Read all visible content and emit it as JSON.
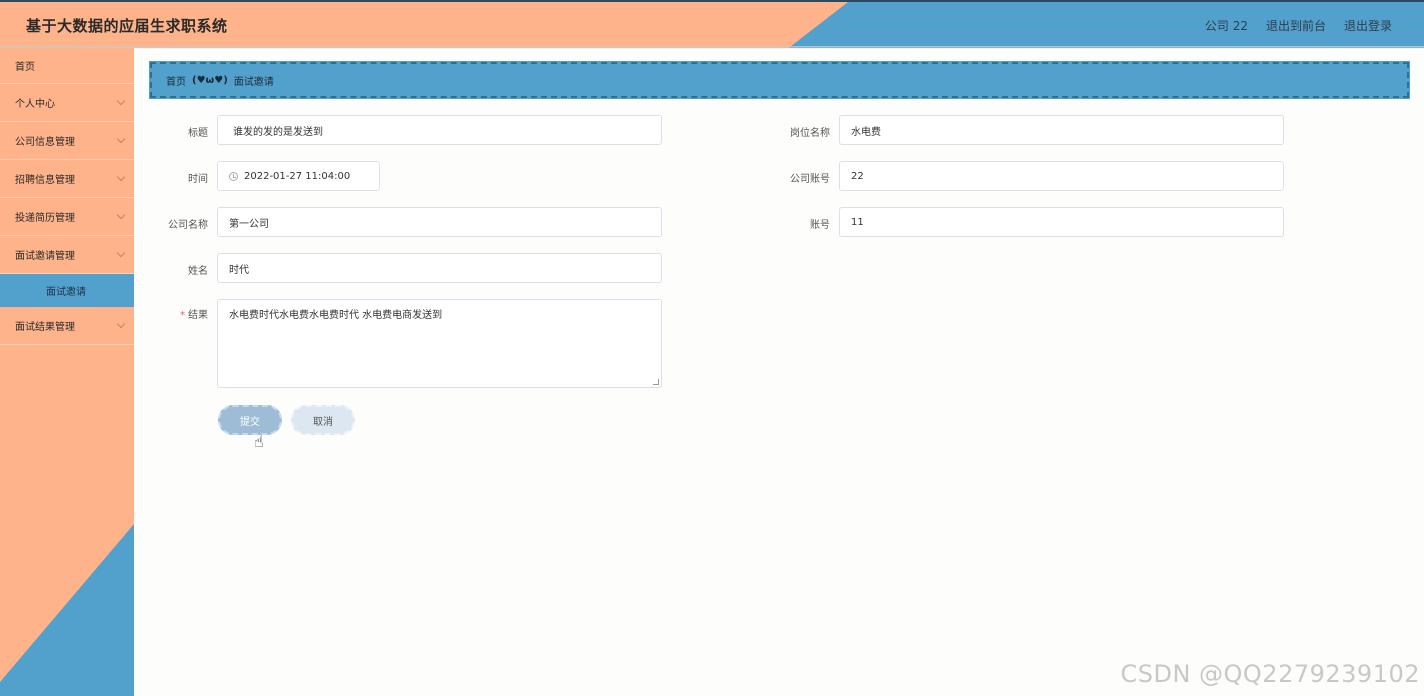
{
  "header": {
    "title": "基于大数据的应届生求职系统",
    "user": "公司 22",
    "front_link": "退出到前台",
    "logout": "退出登录"
  },
  "sidebar": {
    "items": [
      {
        "label": "首页"
      },
      {
        "label": "个人中心"
      },
      {
        "label": "公司信息管理"
      },
      {
        "label": "招聘信息管理"
      },
      {
        "label": "投递简历管理"
      },
      {
        "label": "面试邀请管理"
      },
      {
        "label": "面试邀请"
      },
      {
        "label": "面试结果管理"
      }
    ]
  },
  "breadcrumb": {
    "home": "首页",
    "separator": "(♥ω♥)",
    "current": "面试邀请"
  },
  "form": {
    "title_label": "标题",
    "title_value": "谁发的发的是发送到",
    "time_label": "时间",
    "time_value": "2022-01-27 11:04:00",
    "company_name_label": "公司名称",
    "company_name_value": "第一公司",
    "name_label": "姓名",
    "name_value": "时代",
    "result_label": "结果",
    "result_required": "*",
    "result_value": "水电费时代水电费水电费时代 水电费电商发送到",
    "position_label": "岗位名称",
    "position_value": "水电费",
    "company_account_label": "公司账号",
    "company_account_value": "22",
    "account_label": "账号",
    "account_value": "11",
    "submit_label": "提交",
    "cancel_label": "取消"
  },
  "watermark": "CSDN @QQ2279239102"
}
